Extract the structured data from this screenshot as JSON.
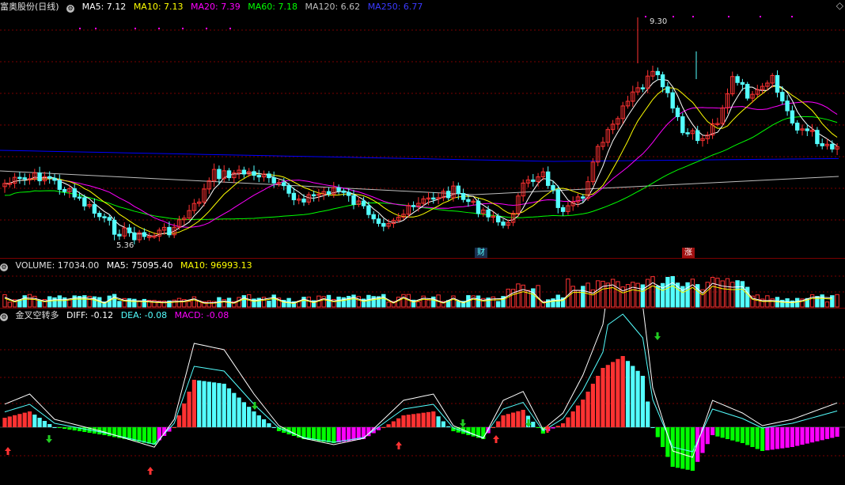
{
  "main": {
    "title": "富奥股份(日线)",
    "ma": [
      {
        "label": "MA5: 7.12",
        "color": "#ffffff"
      },
      {
        "label": "MA10: 7.13",
        "color": "#ffff00"
      },
      {
        "label": "MA20: 7.39",
        "color": "#ff00ff"
      },
      {
        "label": "MA60: 7.18",
        "color": "#00ff00"
      },
      {
        "label": "MA120: 6.62",
        "color": "#bdbdbd"
      },
      {
        "label": "MA250: 6.77",
        "color": "#0000ff"
      }
    ],
    "high_label": "9.30",
    "low_label": "5.36",
    "marker_cai": "财",
    "marker_zhang": "涨",
    "corner_icon": "◇"
  },
  "volume": {
    "label": "VOLUME: 17034.00",
    "ma5": "MA5: 75095.40",
    "ma10": "MA10: 96993.13"
  },
  "macd": {
    "name": "金叉空转多",
    "diff": "DIFF: -0.12",
    "dea": "DEA: -0.08",
    "macd": "MACD: -0.08"
  },
  "colors": {
    "up": "#ff3232",
    "down": "#54ffff",
    "ma5": "#ffffff",
    "ma10": "#ffff00",
    "ma20": "#ff00ff",
    "ma60": "#00ff00",
    "ma120": "#bdbdbd",
    "ma250": "#0000ff",
    "macd_neg": "#ff00ff",
    "macd_neg2": "#00ff00",
    "grid": "#7a0000"
  }
}
